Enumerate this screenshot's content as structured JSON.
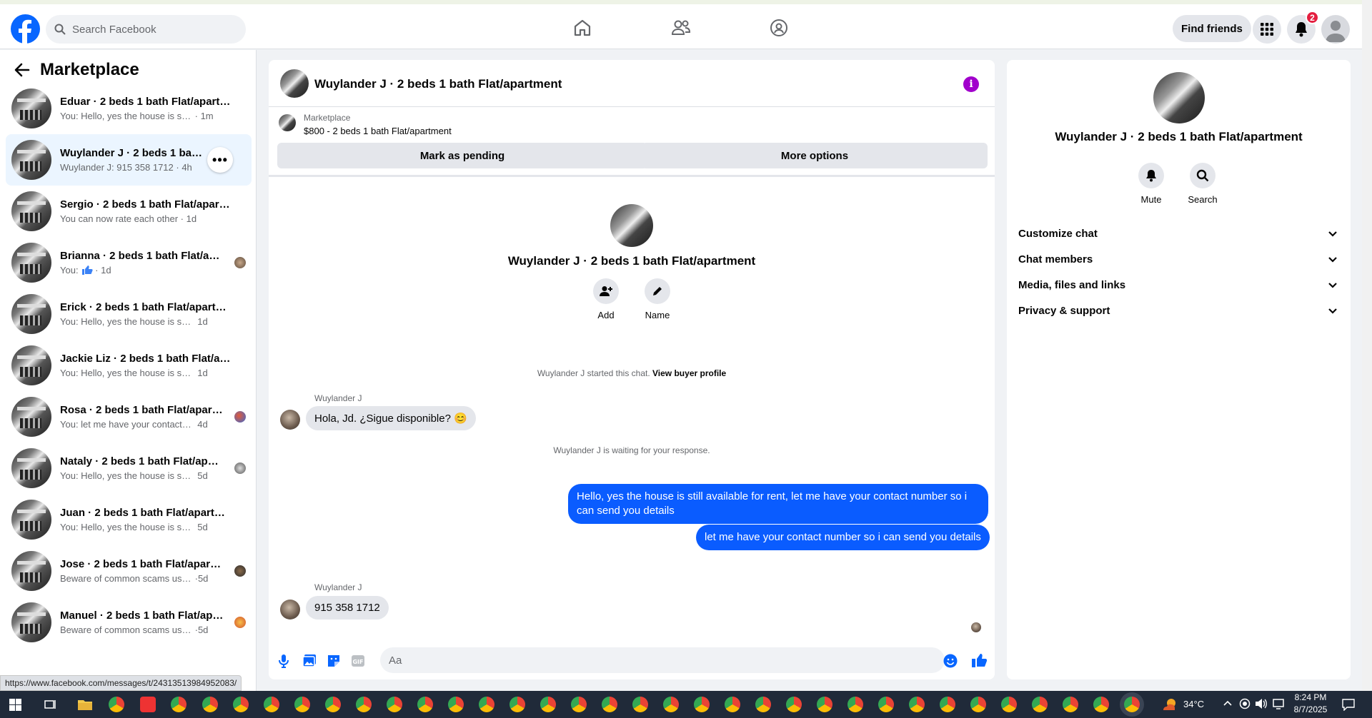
{
  "topbar": {
    "search_placeholder": "Search Facebook",
    "find_friends": "Find friends",
    "notif_count": "2"
  },
  "left": {
    "title": "Marketplace",
    "conversations": [
      {
        "title": "Eduar · 2 beds 1 bath Flat/apartment",
        "preview": "You: Hello, yes the house is still availa...",
        "time": "1m"
      },
      {
        "title": "Wuylander J · 2 beds 1 bath Flat/apartment",
        "preview": "Wuylander J: 915 358 1712",
        "time": "4h"
      },
      {
        "title": "Sergio · 2 beds 1 bath Flat/apartment",
        "preview": "You can now rate each other",
        "time": "1d"
      },
      {
        "title": "Brianna · 2 beds 1 bath Flat/apartment",
        "preview": "You:",
        "time": "1d"
      },
      {
        "title": "Erick · 2 beds 1 bath Flat/apartment",
        "preview": "You: Hello, yes the house is still availa...",
        "time": "1d"
      },
      {
        "title": "Jackie Liz · 2 beds 1 bath Flat/apartment",
        "preview": "You: Hello, yes the house is still availa...",
        "time": "1d"
      },
      {
        "title": "Rosa · 2 beds 1 bath Flat/apartment",
        "preview": "You: let me have your contact num...",
        "time": "4d"
      },
      {
        "title": "Nataly · 2 beds 1 bath Flat/apartment",
        "preview": "You: Hello, yes the house is still ava...",
        "time": "5d"
      },
      {
        "title": "Juan · 2 beds 1 bath Flat/apartment",
        "preview": "You: Hello, yes the house is still availa...",
        "time": "5d"
      },
      {
        "title": "Jose · 2 beds 1 bath Flat/apartment",
        "preview": "Beware of common scams using p...",
        "time": "5d"
      },
      {
        "title": "Manuel · 2 beds 1 bath Flat/apartment",
        "preview": "Beware of common scams using p...",
        "time": "5d"
      }
    ]
  },
  "chat": {
    "title": "Wuylander J · 2 beds 1 bath Flat/apartment",
    "listing_label": "Marketplace",
    "listing_desc": "$800 - 2 beds 1 bath Flat/apartment",
    "mark_pending": "Mark as pending",
    "more_options": "More options",
    "profile_name": "Wuylander J · 2 beds 1 bath Flat/apartment",
    "add_label": "Add",
    "name_label": "Name",
    "started_text": "Wuylander J started this chat.",
    "view_profile": "View buyer profile",
    "sender1": "Wuylander J",
    "msg1": "Hola, Jd. ¿Sigue disponible? 😊",
    "waiting": "Wuylander J is waiting for your response.",
    "out1": "Hello, yes the house is still available for rent, let me have your contact number so i can send you details",
    "out2": "let me have your contact number so i can send you details",
    "sender2": "Wuylander J",
    "msg2": "915 358 1712",
    "input_placeholder": "Aa"
  },
  "right": {
    "title": "Wuylander J · 2 beds 1 bath Flat/apartment",
    "mute": "Mute",
    "search": "Search",
    "rows": [
      "Customize chat",
      "Chat members",
      "Media, files and links",
      "Privacy & support"
    ]
  },
  "status_url": "https://www.facebook.com/messages/t/24313513984952083/",
  "taskbar": {
    "temp": "34°C",
    "time": "8:24 PM",
    "date": "8/7/2025"
  },
  "colors": {
    "brand": "#0866ff",
    "outgoing": "#0a5cff",
    "info": "#a100cc"
  }
}
